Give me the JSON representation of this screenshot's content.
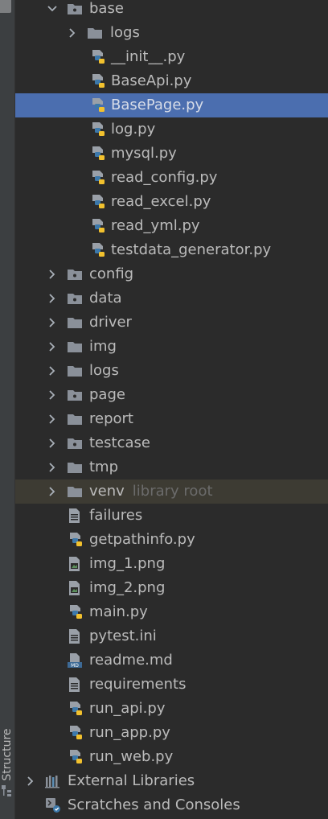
{
  "sidebar": {
    "structure_label": "Structure"
  },
  "tree": {
    "base": "base",
    "logs_sub": "logs",
    "files_base": [
      "__init__.py",
      "BaseApi.py",
      "BasePage.py",
      "log.py",
      "mysql.py",
      "read_config.py",
      "read_excel.py",
      "read_yml.py",
      "testdata_generator.py"
    ],
    "folders": [
      "config",
      "data",
      "driver",
      "img",
      "logs",
      "page",
      "report",
      "testcase",
      "tmp"
    ],
    "venv": "venv",
    "venv_hint": "library root",
    "root_files": [
      "failures",
      "getpathinfo.py",
      "img_1.png",
      "img_2.png",
      "main.py",
      "pytest.ini",
      "readme.md",
      "requirements",
      "run_api.py",
      "run_app.py",
      "run_web.py"
    ],
    "external_libraries": "External Libraries",
    "scratches": "Scratches and Consoles",
    "selected": "BasePage.py"
  },
  "colors": {
    "background": "#2b2b2b",
    "selection": "#4b6eaf",
    "folder": "#8a9099",
    "python_blue": "#3c78aa",
    "python_yellow": "#f2c12e"
  }
}
